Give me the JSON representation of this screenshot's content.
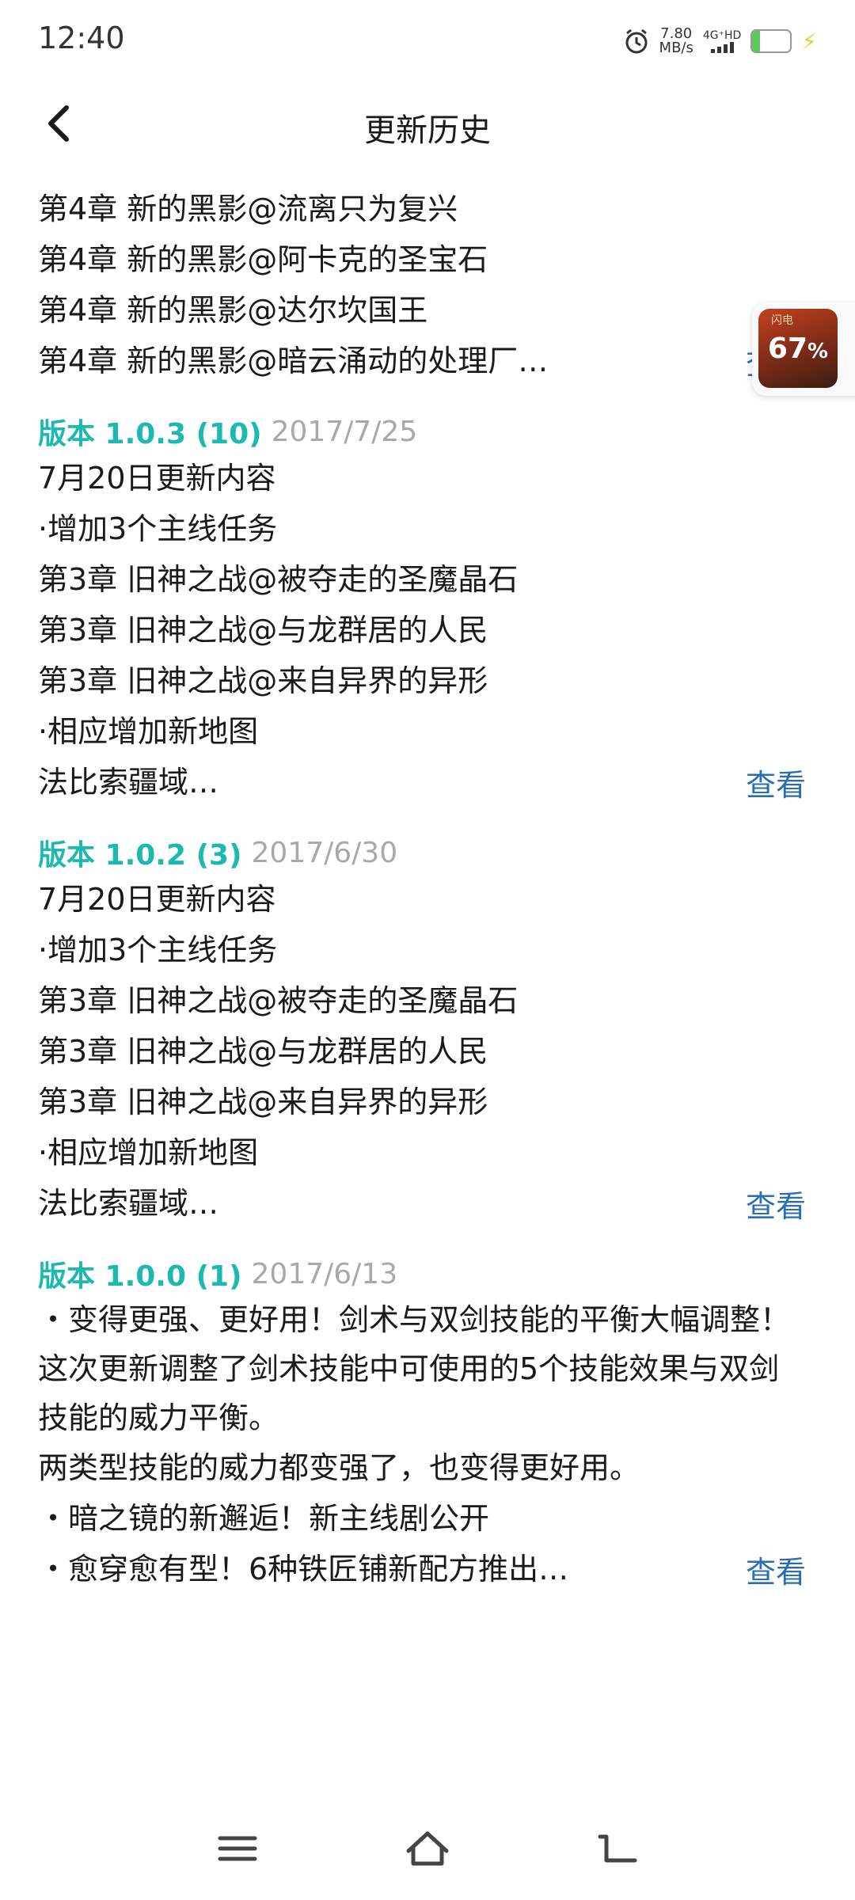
{
  "status_bar": {
    "time": "12:40",
    "speed_value": "7.80",
    "speed_unit": "MB/s",
    "network": "4G⁺HD",
    "battery": "20",
    "battery_level": 0.2
  },
  "header": {
    "title": "更新历史"
  },
  "colors": {
    "accent": "#1bb9b0",
    "link": "#2a6db0",
    "date": "#a8a8a8",
    "text": "#1a1a1a"
  },
  "floating_widget": {
    "text": "67",
    "unit": "%",
    "badge": "闪电"
  },
  "versions": [
    {
      "label": "",
      "date": "",
      "lines": [
        "第4章 新的黑影@流离只为复兴",
        "第4章 新的黑影@阿卡克的圣宝石",
        "第4章 新的黑影@达尔坎国王"
      ],
      "last_line": "第4章 新的黑影@暗云涌动的处理厂…",
      "view_label": "查看"
    },
    {
      "label": "版本 1.0.3 (10)",
      "date": "2017/7/25",
      "lines": [
        "7月20日更新内容",
        "·增加3个主线任务",
        "第3章 旧神之战@被夺走的圣魔晶石",
        "第3章 旧神之战@与龙群居的人民",
        "第3章 旧神之战@来自异界的异形",
        "·相应增加新地图"
      ],
      "last_line": "法比索疆域…",
      "view_label": "查看"
    },
    {
      "label": "版本 1.0.2 (3)",
      "date": "2017/6/30",
      "lines": [
        "7月20日更新内容",
        "·增加3个主线任务",
        "第3章 旧神之战@被夺走的圣魔晶石",
        "第3章 旧神之战@与龙群居的人民",
        "第3章 旧神之战@来自异界的异形",
        "·相应增加新地图"
      ],
      "last_line": "法比索疆域…",
      "view_label": "查看"
    },
    {
      "label": "版本 1.0.0 (1)",
      "date": "2017/6/13",
      "lines": [
        "・变得更强、更好用！剑术与双剑技能的平衡大幅调整！",
        "这次更新调整了剑术技能中可使用的5个技能效果与双剑技能的威力平衡。",
        "两类型技能的威力都变强了，也变得更好用。",
        "・暗之镜的新邂逅！新主线剧公开"
      ],
      "last_line": "・愈穿愈有型！6种铁匠铺新配方推出…",
      "view_label": "查看"
    }
  ],
  "nav": {
    "menu_icon": "menu-icon",
    "home_icon": "home-icon",
    "back_icon": "return-icon"
  }
}
